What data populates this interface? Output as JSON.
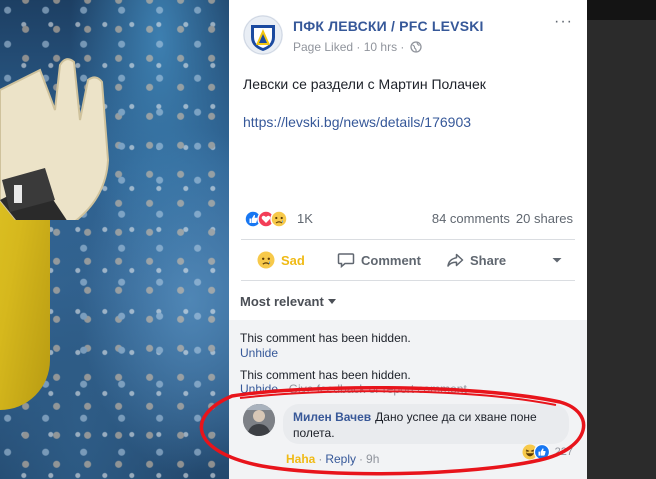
{
  "post": {
    "page_name": "ПФК ЛЕВСКИ / PFC LEVSKI",
    "meta_liked": "Page Liked",
    "meta_sep": " · ",
    "meta_time": "10 hrs",
    "text": "Левски се раздели с Мартин Полачек",
    "link": "https://levski.bg/news/details/176903",
    "more_label": "···"
  },
  "stats": {
    "reactions": "1K",
    "comments": "84 comments",
    "shares": "20 shares"
  },
  "actions": {
    "sad": "Sad",
    "comment": "Comment",
    "share": "Share"
  },
  "sort": {
    "label": "Most relevant"
  },
  "hidden_comments": [
    {
      "message": "This comment has been hidden.",
      "unhide": "Unhide",
      "extra": ""
    },
    {
      "message": "This comment has been hidden.",
      "unhide": "Unhide",
      "extra": " · Give feedback or report comment"
    }
  ],
  "comment": {
    "author": "Милен Вачев",
    "text": "Дано успее да си хване поне полета.",
    "reaction_label": "Haha",
    "reply": "Reply",
    "time": "9h",
    "reaction_count": "227"
  },
  "colors": {
    "fb_blue": "#365899",
    "sad_yellow": "#f0ba15",
    "annotation_red": "#e8141b"
  },
  "icons": [
    "like-icon",
    "love-icon",
    "sad-icon",
    "globe-icon",
    "comment-icon",
    "share-icon",
    "caret-down-icon",
    "haha-icon"
  ]
}
